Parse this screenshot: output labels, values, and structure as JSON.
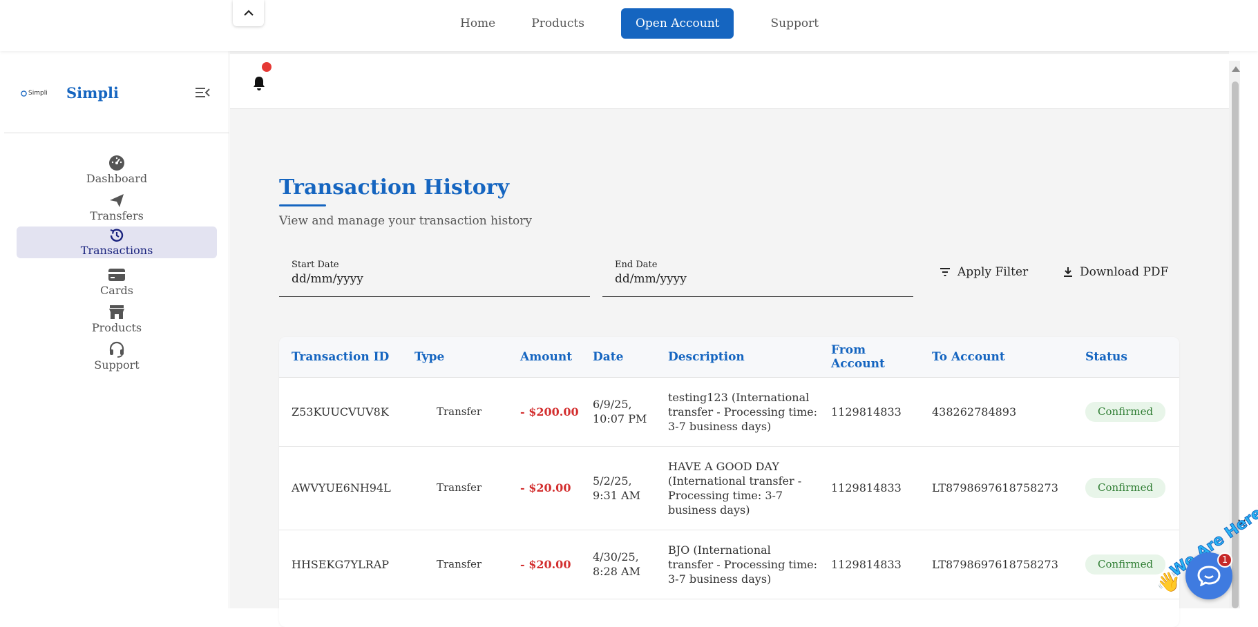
{
  "topnav": {
    "items": [
      "Home",
      "Products",
      "Open Account",
      "Support"
    ]
  },
  "sidebar": {
    "brand_logo_text": "Simpli",
    "brand_name": "Simpli",
    "items": [
      {
        "label": "Dashboard",
        "icon": "dashboard-icon"
      },
      {
        "label": "Transfers",
        "icon": "send-icon"
      },
      {
        "label": "Transactions",
        "icon": "history-icon",
        "active": true
      },
      {
        "label": "Cards",
        "icon": "card-icon"
      },
      {
        "label": "Products",
        "icon": "store-icon"
      },
      {
        "label": "Support",
        "icon": "headset-icon"
      }
    ]
  },
  "page": {
    "title": "Transaction History",
    "subtitle": "View and manage your transaction history"
  },
  "filters": {
    "start_label": "Start Date",
    "start_value": "dd/mm/yyyy",
    "end_label": "End Date",
    "end_value": "dd/mm/yyyy",
    "apply_label": "Apply Filter",
    "download_label": "Download PDF"
  },
  "table": {
    "headers": [
      "Transaction ID",
      "Type",
      "Amount",
      "Date",
      "Description",
      "From Account",
      "To Account",
      "Status"
    ],
    "rows": [
      {
        "id": "Z53KUUCVUV8K",
        "type": "Transfer",
        "amount": "- $200.00",
        "date": "6/9/25, 10:07 PM",
        "description": "testing123 (International transfer - Processing time: 3-7 business days)",
        "from": "1129814833",
        "to": "438262784893",
        "status": "Confirmed"
      },
      {
        "id": "AWVYUE6NH94L",
        "type": "Transfer",
        "amount": "- $20.00",
        "date": "5/2/25, 9:31 AM",
        "description": "HAVE A GOOD DAY (International transfer - Processing time: 3-7 business days)",
        "from": "1129814833",
        "to": "LT8798697618758273",
        "status": "Confirmed"
      },
      {
        "id": "HHSEKG7YLRAP",
        "type": "Transfer",
        "amount": "- $20.00",
        "date": "4/30/25, 8:28 AM",
        "description": "BJO (International transfer - Processing time: 3-7 business days)",
        "from": "1129814833",
        "to": "LT8798697618758273",
        "status": "Confirmed"
      }
    ]
  },
  "chat": {
    "tag": "We Are Here!",
    "badge": "1",
    "close": "✕"
  },
  "colors": {
    "primary": "#1565c0",
    "negative": "#d32f2f",
    "confirmed_bg": "#e8f5e9",
    "confirmed_text": "#2e7d32"
  }
}
